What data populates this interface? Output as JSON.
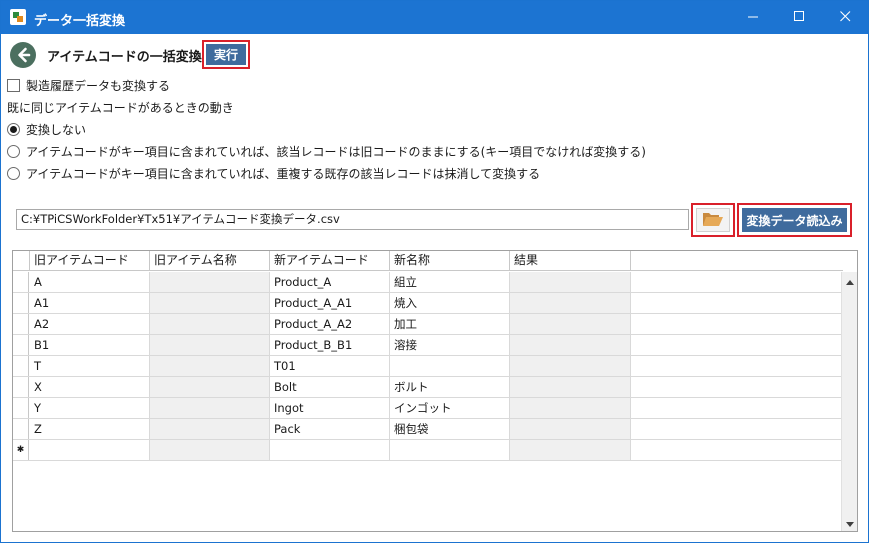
{
  "window": {
    "title": "データ一括変換"
  },
  "page": {
    "title": "アイテムコードの一括変換",
    "run_label": "実行"
  },
  "options": {
    "include_history_label": "製造履歴データも変換する",
    "include_history_checked": false,
    "existing_label": "既に同じアイテムコードがあるときの動き",
    "radio_options": [
      {
        "label": "変換しない",
        "checked": true
      },
      {
        "label": "アイテムコードがキー項目に含まれていれば、該当レコードは旧コードのままにする(キー項目でなければ変換する)",
        "checked": false
      },
      {
        "label": "アイテムコードがキー項目に含まれていれば、重複する既存の該当レコードは抹消して変換する",
        "checked": false
      }
    ]
  },
  "file": {
    "path": "C:¥TPiCSWorkFolder¥Tx51¥アイテムコード変換データ.csv",
    "load_label": "変換データ読込み"
  },
  "grid": {
    "columns": [
      "旧アイテムコード",
      "旧アイテム名称",
      "新アイテムコード",
      "新名称",
      "結果"
    ],
    "rows": [
      [
        "A",
        "",
        "Product_A",
        "組立",
        ""
      ],
      [
        "A1",
        "",
        "Product_A_A1",
        "焼入",
        ""
      ],
      [
        "A2",
        "",
        "Product_A_A2",
        "加工",
        ""
      ],
      [
        "B1",
        "",
        "Product_B_B1",
        "溶接",
        ""
      ],
      [
        "T",
        "",
        "T01",
        "",
        ""
      ],
      [
        "X",
        "",
        "Bolt",
        "ボルト",
        ""
      ],
      [
        "Y",
        "",
        "Ingot",
        "インゴット",
        ""
      ],
      [
        "Z",
        "",
        "Pack",
        "梱包袋",
        ""
      ]
    ],
    "new_row_marker": "✱"
  },
  "colors": {
    "titlebar": "#1c74d2",
    "button": "#3f6b9d",
    "highlight": "#d9202a",
    "readonly_cell": "#f0f0f0"
  },
  "icons": {
    "app": "app-icon",
    "back": "back-arrow-icon",
    "folder": "folder-open-icon",
    "minimize": "minimize-icon",
    "maximize": "maximize-icon",
    "close": "close-icon"
  }
}
